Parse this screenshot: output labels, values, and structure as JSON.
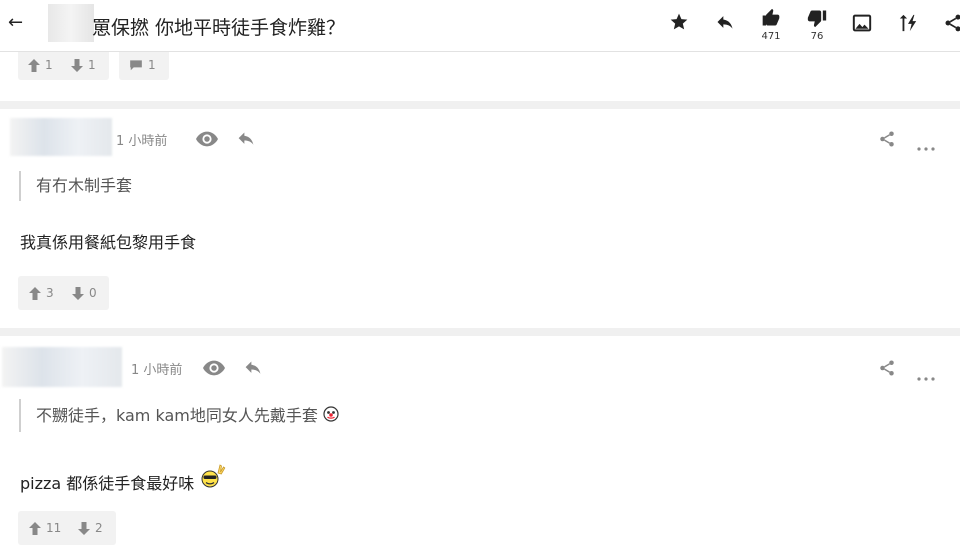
{
  "header": {
    "back_glyph": "←",
    "title": "罳保撚 你地平時徒手食炸雞？",
    "like_count": "471",
    "dislike_count": "76"
  },
  "previous_post": {
    "upvotes": "1",
    "downvotes": "1",
    "comments": "1"
  },
  "posts": [
    {
      "time": "1 小時前",
      "quote": "有冇木制手套",
      "body": "我真係用餐紙包黎用手食",
      "upvotes": "3",
      "downvotes": "0"
    },
    {
      "time": "1 小時前",
      "quote": "不嬲徒手，kam kam地同女人先戴手套",
      "body": "pizza 都係徒手食最好味",
      "upvotes": "11",
      "downvotes": "2"
    }
  ],
  "icons": {
    "toolbar": [
      "star-icon",
      "reply-icon",
      "thumbs-up-icon",
      "thumbs-down-icon",
      "image-icon",
      "sort-icon",
      "share-icon"
    ],
    "post": [
      "eye-icon",
      "reply-icon",
      "share-icon",
      "more-icon"
    ]
  }
}
